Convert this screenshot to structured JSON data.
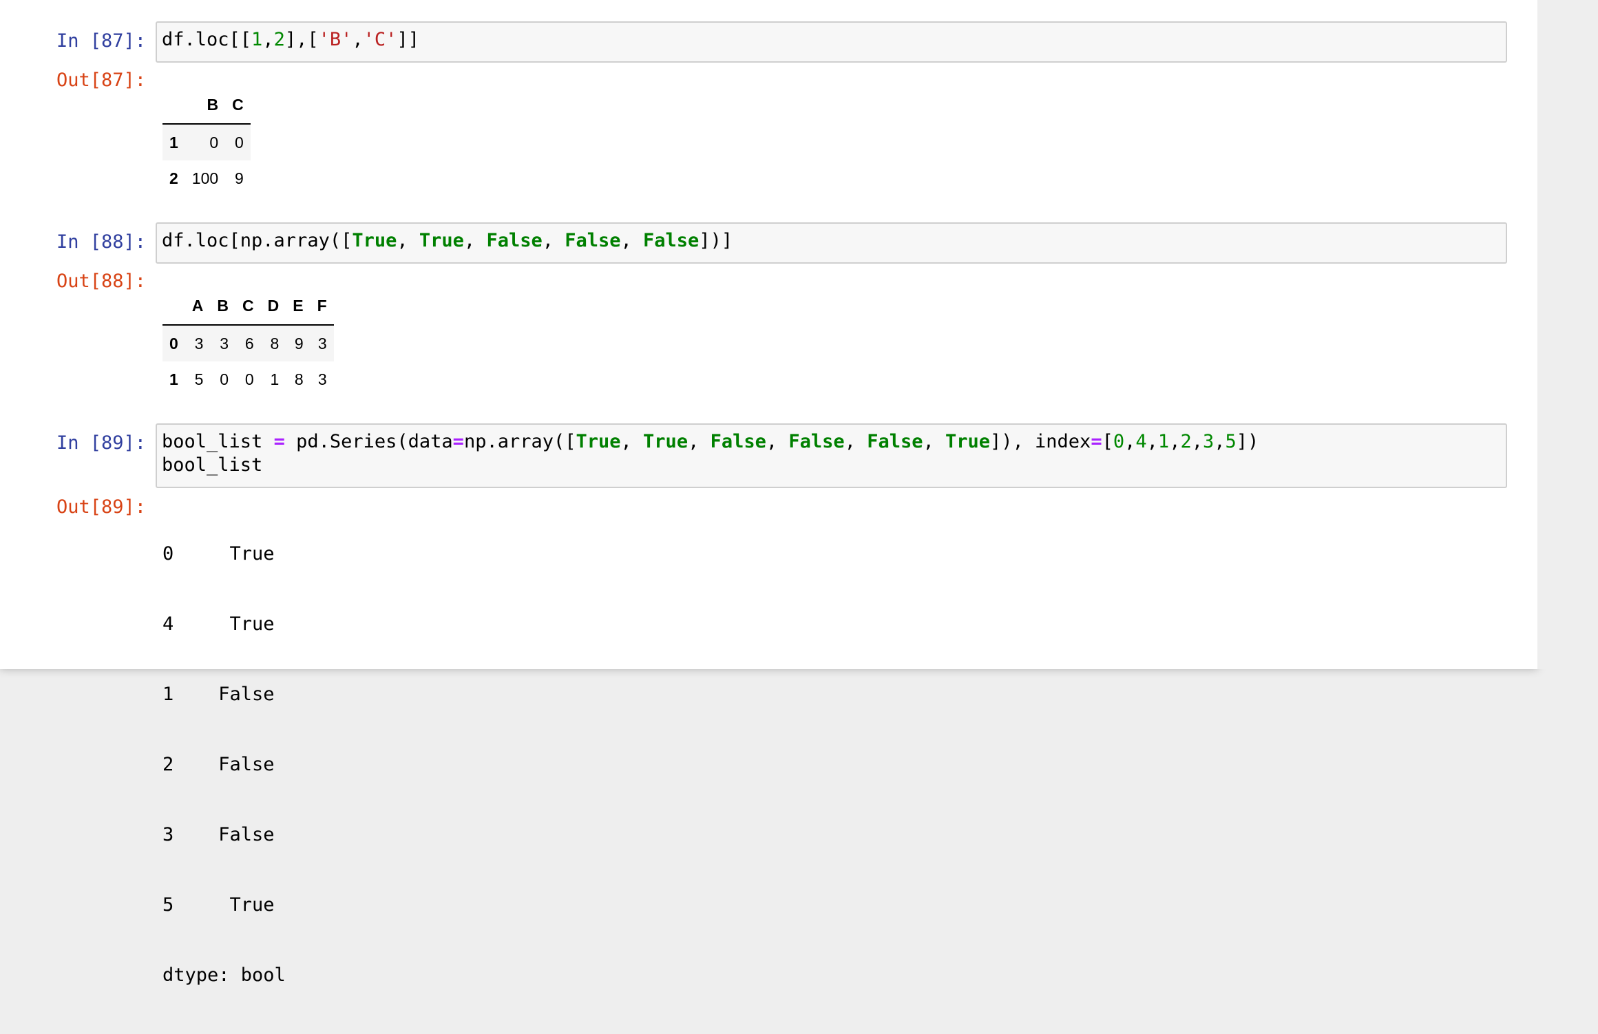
{
  "cells": [
    {
      "in_prompt": "In [87]:",
      "out_prompt": "Out[87]:",
      "code_text": "df.loc[[1,2],['B','C']]",
      "output_table": {
        "columns": [
          "",
          "B",
          "C"
        ],
        "rows": [
          {
            "index": "1",
            "values": [
              "0",
              "0"
            ]
          },
          {
            "index": "2",
            "values": [
              "100",
              "9"
            ]
          }
        ]
      }
    },
    {
      "in_prompt": "In [88]:",
      "out_prompt": "Out[88]:",
      "code_text": "df.loc[np.array([True, True, False, False, False])]",
      "output_table": {
        "columns": [
          "",
          "A",
          "B",
          "C",
          "D",
          "E",
          "F"
        ],
        "rows": [
          {
            "index": "0",
            "values": [
              "3",
              "3",
              "6",
              "8",
              "9",
              "3"
            ]
          },
          {
            "index": "1",
            "values": [
              "5",
              "0",
              "0",
              "1",
              "8",
              "3"
            ]
          }
        ]
      }
    },
    {
      "in_prompt": "In [89]:",
      "out_prompt": "Out[89]:",
      "code_text": "bool_list = pd.Series(data=np.array([True, True, False, False, False, True]), index=[0,4,1,2,3,5])\nbool_list",
      "output_lines": [
        "0     True",
        "4     True",
        "1    False",
        "2    False",
        "3    False",
        "5     True",
        "dtype: bool"
      ]
    }
  ],
  "colors": {
    "in_prompt": "#303f9f",
    "out_prompt": "#d84315",
    "keyword": "#008000",
    "number": "#008800",
    "string": "#ba2121",
    "operator": "#aa22ff",
    "input_background": "#f7f7f7"
  }
}
